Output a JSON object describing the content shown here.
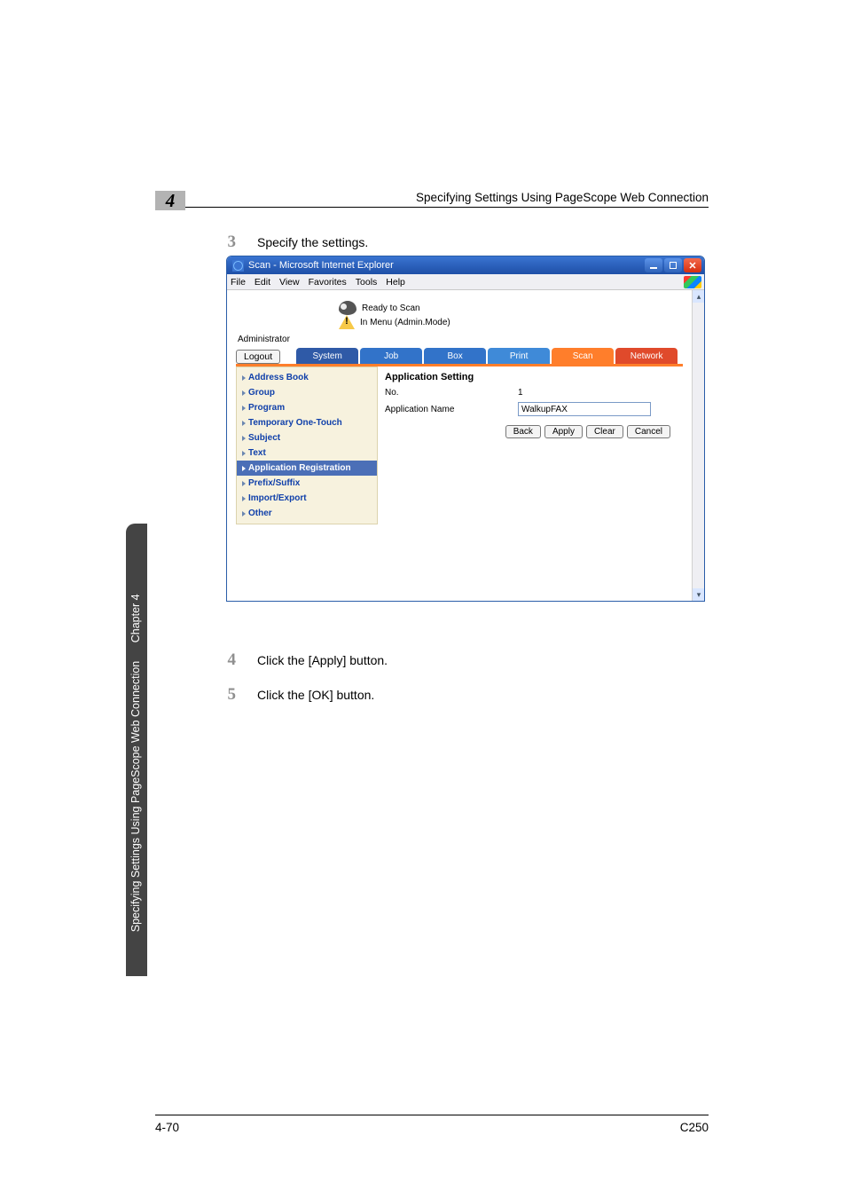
{
  "header": {
    "chapter_number": "4",
    "title": "Specifying Settings Using PageScope Web Connection"
  },
  "steps": {
    "s3": {
      "n": "3",
      "text": "Specify the settings."
    },
    "s4": {
      "n": "4",
      "text": "Click the [Apply] button."
    },
    "s5": {
      "n": "5",
      "text": "Click the [OK] button."
    }
  },
  "browser": {
    "title": "Scan - Microsoft Internet Explorer",
    "menus": [
      "File",
      "Edit",
      "View",
      "Favorites",
      "Tools",
      "Help"
    ],
    "status1": "Ready to Scan",
    "status2": "In Menu (Admin.Mode)",
    "role": "Administrator",
    "logout": "Logout",
    "tabs": {
      "system": "System",
      "job": "Job",
      "box": "Box",
      "print": "Print",
      "scan": "Scan",
      "network": "Network"
    },
    "sidebar": [
      "Address Book",
      "Group",
      "Program",
      "Temporary One-Touch",
      "Subject",
      "Text",
      "Application Registration",
      "Prefix/Suffix",
      "Import/Export",
      "Other"
    ],
    "main": {
      "heading": "Application Setting",
      "no_label": "No.",
      "no_value": "1",
      "appname_label": "Application Name",
      "appname_value": "WalkupFAX",
      "buttons": {
        "back": "Back",
        "apply": "Apply",
        "clear": "Clear",
        "cancel": "Cancel"
      }
    }
  },
  "side_tab": {
    "chapter": "Chapter 4",
    "title": "Specifying Settings Using PageScope Web Connection"
  },
  "footer": {
    "left": "4-70",
    "right": "C250"
  }
}
